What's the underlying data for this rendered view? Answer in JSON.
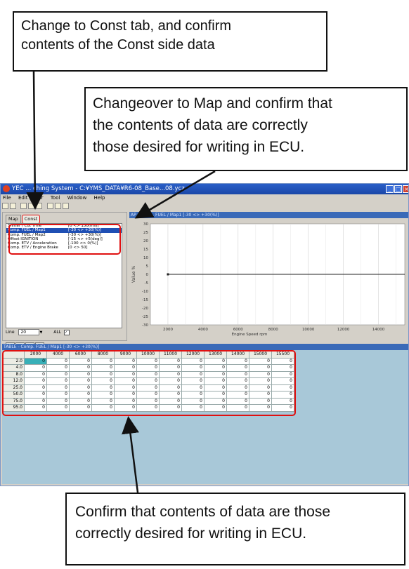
{
  "callouts": {
    "const_tab": "Change to Const tab, and confirm\ncontents of the Const side data",
    "map_confirm": "Changeover to Map and confirm that\nthe contents of data are correctly\nthose desired for writing in ECU.",
    "table_confirm": "Confirm that contents of data are those\ncorrectly desired for writing in ECU."
  },
  "window": {
    "title": "YEC ... ching System - C:¥YMS_DATA¥R6-08_Base...08.ycz",
    "title_left": "YEC",
    "title_mid": "ching System - C:¥YMS_DATA¥R6-08_BaseD",
    "title_end": "08.ycz"
  },
  "menu": [
    "File",
    "Edit",
    "itor",
    "Tool",
    "Window",
    "Help"
  ],
  "left_pane": {
    "tabs": [
      "Map",
      "Const"
    ],
    "items": [
      {
        "name": "Shifter / Cut Time",
        "range": "[0 <> 150(ms)]"
      },
      {
        "name": "Comp. FUEL / Map1",
        "range": "[-30 <> +30(%)]"
      },
      {
        "name": "Comp. FUEL / Map2",
        "range": "[-30 <> +30(%)]"
      },
      {
        "name": "Offset IGNITION",
        "range": "[-15 <> +5(deg)]"
      },
      {
        "name": "Comp. ETV / Acceleration",
        "range": "[-100 <> 0(%)]"
      },
      {
        "name": "Comp. ETV / Engine Brake",
        "range": "[0 <> 50]"
      }
    ],
    "line_label": "Line",
    "line_value": "20",
    "all_label": "ALL",
    "nav": [
      "≫",
      "∨",
      "∧",
      "≪"
    ]
  },
  "chart_pane": {
    "title": "AP - Comp. FUEL / Map1       [-30 <> +30(%)]"
  },
  "chart_data": {
    "type": "line",
    "title": "",
    "xlabel": "Engine Speed rpm",
    "ylabel": "Value %",
    "xlim": [
      0,
      15500
    ],
    "ylim": [
      -30,
      30
    ],
    "y_ticks": [
      30,
      25,
      20,
      15,
      10,
      5,
      0,
      -5,
      -10,
      -15,
      -20,
      -25,
      -30
    ],
    "x_ticks": [
      2000,
      4000,
      6000,
      8000,
      10000,
      12000,
      14000
    ],
    "series": [
      {
        "x": [
          2000,
          4000,
          6000,
          8000,
          9000,
          10000,
          11000,
          12000,
          13000,
          14000,
          15000,
          15500
        ],
        "y": [
          0,
          0,
          0,
          0,
          0,
          0,
          0,
          0,
          0,
          0,
          0,
          0
        ]
      }
    ]
  },
  "table_pane": {
    "title": "TABLE - Comp. FUEL / Map1        [-30 <> +30(%)]",
    "columns": [
      "2000",
      "4000",
      "6000",
      "8000",
      "9000",
      "10000",
      "11000",
      "12000",
      "13000",
      "14000",
      "15000",
      "15500"
    ],
    "rows": [
      "2.0",
      "4.0",
      "8.0",
      "12.0",
      "25.0",
      "50.0",
      "75.0",
      "95.0"
    ],
    "cell_value": "0"
  },
  "colors": {
    "highlight_red": "#e01010",
    "title_blue": "#1a47a8",
    "selected_cell": "#38b0b8",
    "table_bg": "#a8c8d8"
  }
}
